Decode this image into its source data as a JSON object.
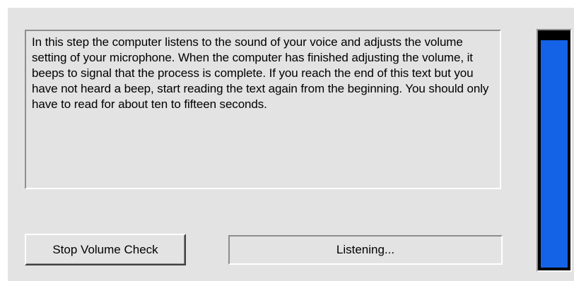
{
  "instructions": {
    "text": "In this step the computer listens to the sound of your voice and adjusts the volume setting of your microphone. When the computer has finished adjusting the volume, it beeps to signal that the process is complete. If you reach the end of this text but you have not heard a beep, start reading the text again from the beginning. You should only have to read for about ten to fifteen seconds."
  },
  "controls": {
    "stop_button_label": "Stop Volume Check",
    "status_text": "Listening..."
  },
  "meter": {
    "level_percent": 97,
    "fill_color": "#1463e6",
    "background_color": "#000000"
  }
}
